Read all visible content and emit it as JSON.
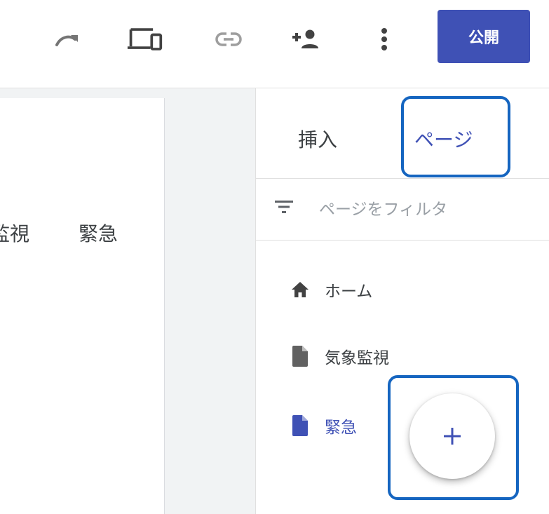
{
  "toolbar": {
    "icons": [
      "redo-icon",
      "preview-devices-icon",
      "link-icon",
      "share-icon",
      "more-vert-icon"
    ],
    "publish_label": "公開",
    "accent_color": "#3f51b5"
  },
  "preview": {
    "nav_items": [
      "監視",
      "緊急"
    ]
  },
  "side_panel": {
    "tabs": [
      {
        "label": "挿入",
        "selected": false
      },
      {
        "label": "ページ",
        "selected": true
      }
    ],
    "filter": {
      "icon": "filter-icon",
      "placeholder": "ページをフィルタ",
      "value": ""
    },
    "pages": [
      {
        "label": "ホーム",
        "icon": "home-icon",
        "active": false
      },
      {
        "label": "気象監視",
        "icon": "page-icon",
        "active": false
      },
      {
        "label": "緊急",
        "icon": "page-icon",
        "active": true
      }
    ],
    "add_page_button": {
      "icon": "plus-icon"
    }
  },
  "annotations": {
    "highlight_color": "#1565c0"
  }
}
